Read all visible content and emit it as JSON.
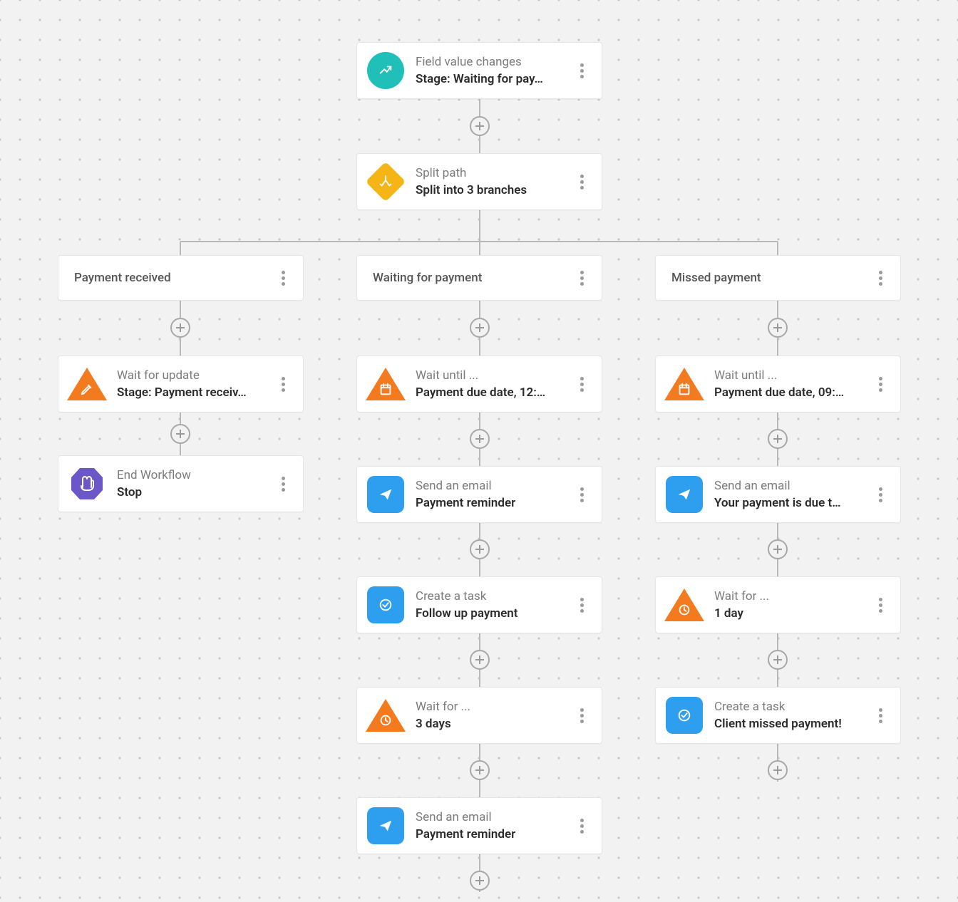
{
  "trigger": {
    "title": "Field value changes",
    "subtitle": "Stage: Waiting for pay…"
  },
  "split": {
    "title": "Split path",
    "subtitle": "Split into 3 branches"
  },
  "branches": {
    "left": {
      "label": "Payment received",
      "nodes": [
        {
          "title": "Wait for update",
          "subtitle": "Stage: Payment receiv…",
          "icon": "pencil-triangle"
        },
        {
          "title": "End Workflow",
          "subtitle": "Stop",
          "icon": "stop-hex"
        }
      ]
    },
    "center": {
      "label": "Waiting for payment",
      "nodes": [
        {
          "title": "Wait until ...",
          "subtitle": "Payment due date, 12:…",
          "icon": "calendar-triangle"
        },
        {
          "title": "Send an email",
          "subtitle": "Payment reminder",
          "icon": "send-square"
        },
        {
          "title": "Create a task",
          "subtitle": "Follow up payment",
          "icon": "check-square"
        },
        {
          "title": "Wait for ...",
          "subtitle": "3 days",
          "icon": "clock-triangle"
        },
        {
          "title": "Send an email",
          "subtitle": "Payment reminder",
          "icon": "send-square"
        }
      ]
    },
    "right": {
      "label": "Missed payment",
      "nodes": [
        {
          "title": "Wait until ...",
          "subtitle": "Payment due date, 09:…",
          "icon": "calendar-triangle"
        },
        {
          "title": "Send an email",
          "subtitle": "Your payment is due t…",
          "icon": "send-square"
        },
        {
          "title": "Wait for ...",
          "subtitle": "1 day",
          "icon": "clock-triangle"
        },
        {
          "title": "Create a task",
          "subtitle": "Client missed payment!",
          "icon": "check-square"
        }
      ]
    }
  },
  "colors": {
    "teal": "#20bfb8",
    "amber": "#f5b516",
    "blue": "#2e9fef",
    "orange": "#f37a1f",
    "purple": "#6b57c8"
  }
}
